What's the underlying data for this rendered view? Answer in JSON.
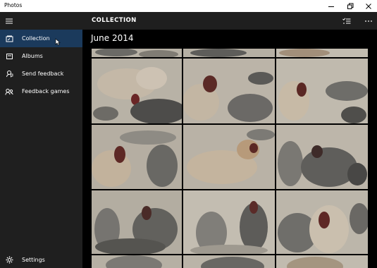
{
  "window": {
    "title": "Photos"
  },
  "sidebar": {
    "items": [
      {
        "label": "Collection",
        "icon": "collection-icon",
        "active": true
      },
      {
        "label": "Albums",
        "icon": "albums-icon",
        "active": false
      },
      {
        "label": "Send feedback",
        "icon": "feedback-icon",
        "active": false
      },
      {
        "label": "Feedback games",
        "icon": "games-icon",
        "active": false
      }
    ],
    "settings_label": "Settings"
  },
  "main": {
    "header_title": "COLLECTION",
    "section_title": "June 2014"
  },
  "photos": [
    {
      "subject": "elephant-seal"
    },
    {
      "subject": "elephant-seal"
    },
    {
      "subject": "elephant-seal"
    },
    {
      "subject": "elephant-seal"
    },
    {
      "subject": "elephant-seal"
    },
    {
      "subject": "elephant-seal"
    },
    {
      "subject": "elephant-seal"
    },
    {
      "subject": "elephant-seal"
    },
    {
      "subject": "elephant-seal"
    },
    {
      "subject": "elephant-seal"
    },
    {
      "subject": "elephant-seal"
    },
    {
      "subject": "elephant-seal"
    },
    {
      "subject": "elephant-seal"
    },
    {
      "subject": "elephant-seal"
    },
    {
      "subject": "elephant-seal"
    }
  ],
  "colors": {
    "sidebar_bg": "#1f1f1f",
    "active_item": "#1b3a5c",
    "content_bg": "#000000",
    "sand": "#b9b3a8"
  }
}
